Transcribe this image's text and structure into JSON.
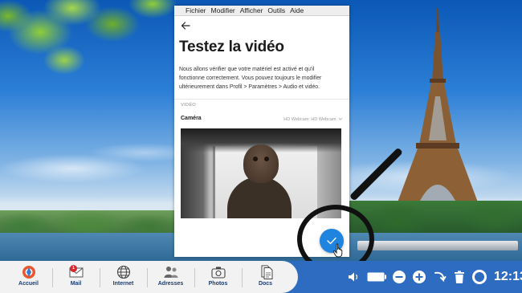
{
  "menubar": {
    "items": [
      "Fichier",
      "Modifier",
      "Afficher",
      "Outils",
      "Aide"
    ]
  },
  "page": {
    "title": "Testez la vidéo",
    "description": "Nous allons vérifier que votre matériel est activé et qu'il fonctionne correctement. Vous pouvez toujours le modifier ultérieurement dans Profil > Paramètres > Audio et vidéo."
  },
  "video_section": {
    "label": "VIDÉO",
    "camera_label": "Caméra",
    "camera_value": "HD Webcam: HD Webcam"
  },
  "dock": {
    "items": [
      {
        "label": "Accueil",
        "icon": "home-logo-icon"
      },
      {
        "label": "Mail",
        "icon": "envelope-icon",
        "badge": "1"
      },
      {
        "label": "Internet",
        "icon": "globe-icon"
      },
      {
        "label": "Adresses",
        "icon": "contacts-icon"
      },
      {
        "label": "Photos",
        "icon": "camera-icon"
      },
      {
        "label": "Docs",
        "icon": "documents-icon"
      }
    ]
  },
  "tray": {
    "icons": [
      "volume-icon",
      "battery-icon",
      "zoom-out-icon",
      "zoom-in-icon",
      "undo-icon",
      "trash-icon",
      "help-lifebuoy-icon"
    ],
    "clock": "12:13"
  },
  "colors": {
    "accent": "#1e84e0",
    "taskbar": "#2d6cc0",
    "dock": "#f2f2f2",
    "badge": "#d9272e"
  }
}
